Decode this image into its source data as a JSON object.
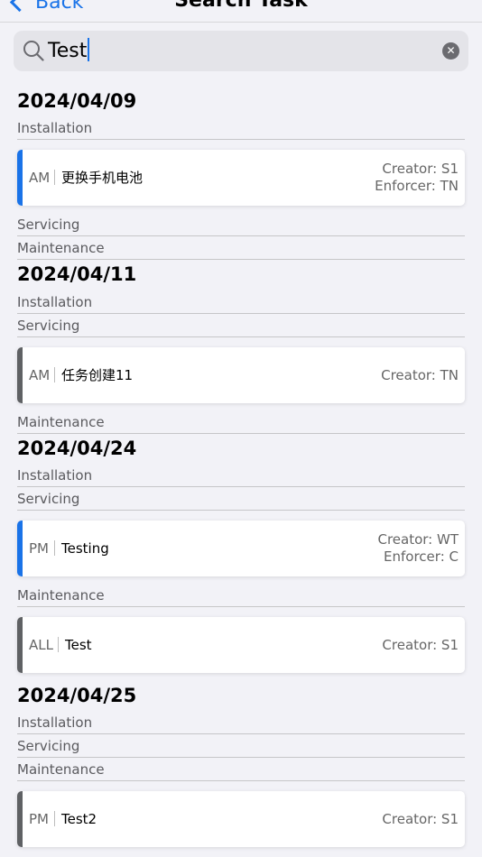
{
  "nav": {
    "back_label": "Back",
    "title": "Search Task"
  },
  "search": {
    "value": "Test"
  },
  "colors": {
    "blue_stripe": "#1a73e8",
    "gray_stripe": "#5f6164",
    "accent": "#1a73e8"
  },
  "sections": [
    {
      "date": "2024/04/09",
      "categories": [
        {
          "label": "Installation",
          "tasks": [
            {
              "period": "AM",
              "name": "更换手机电池",
              "creator": "Creator: S1",
              "enforcer": "Enforcer: TN",
              "stripe": "blue"
            }
          ]
        },
        {
          "label": "Servicing",
          "tasks": []
        },
        {
          "label": "Maintenance",
          "tasks": []
        }
      ]
    },
    {
      "date": "2024/04/11",
      "categories": [
        {
          "label": "Installation",
          "tasks": []
        },
        {
          "label": "Servicing",
          "tasks": [
            {
              "period": "AM",
              "name": "任务创建11",
              "creator": "Creator: TN",
              "enforcer": "",
              "stripe": "gray"
            }
          ]
        },
        {
          "label": "Maintenance",
          "tasks": []
        }
      ]
    },
    {
      "date": "2024/04/24",
      "categories": [
        {
          "label": "Installation",
          "tasks": []
        },
        {
          "label": "Servicing",
          "tasks": [
            {
              "period": "PM",
              "name": "Testing",
              "creator": "Creator: WT",
              "enforcer": "Enforcer: C",
              "stripe": "blue"
            }
          ]
        },
        {
          "label": "Maintenance",
          "tasks": [
            {
              "period": "ALL",
              "name": "Test",
              "creator": "Creator: S1",
              "enforcer": "",
              "stripe": "gray"
            }
          ]
        }
      ]
    },
    {
      "date": "2024/04/25",
      "categories": [
        {
          "label": "Installation",
          "tasks": []
        },
        {
          "label": "Servicing",
          "tasks": []
        },
        {
          "label": "Maintenance",
          "tasks": [
            {
              "period": "PM",
              "name": "Test2",
              "creator": "Creator: S1",
              "enforcer": "",
              "stripe": "gray"
            }
          ]
        }
      ]
    }
  ]
}
